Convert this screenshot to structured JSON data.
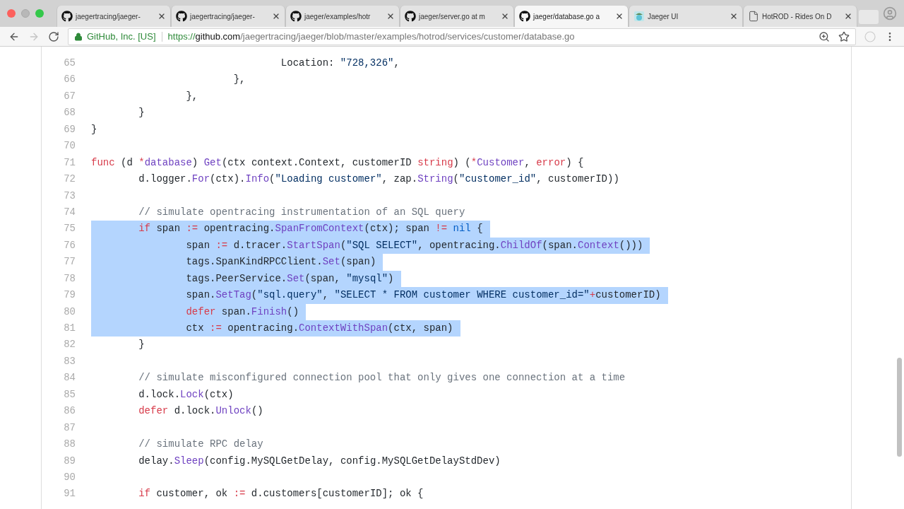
{
  "tabs": [
    {
      "title": "jaegertracing/jaeger-",
      "kind": "github",
      "selected": false
    },
    {
      "title": "jaegertracing/jaeger-",
      "kind": "github",
      "selected": false
    },
    {
      "title": "jaeger/examples/hotr",
      "kind": "github",
      "selected": false
    },
    {
      "title": "jaeger/server.go at m",
      "kind": "github",
      "selected": false
    },
    {
      "title": "jaeger/database.go a",
      "kind": "github",
      "selected": true
    },
    {
      "title": "Jaeger UI",
      "kind": "jaeger",
      "selected": false
    },
    {
      "title": "HotROD - Rides On D",
      "kind": "page",
      "selected": false
    }
  ],
  "address_bar": {
    "site_identity": "GitHub, Inc. [US]",
    "scheme": "https://",
    "host": "github.com",
    "path": "/jaegertracing/jaeger/blob/master/examples/hotrod/services/customer/database.go"
  },
  "code": {
    "lines": [
      {
        "number": "65",
        "selected": false,
        "tokens": [
          {
            "text": "\t\t\t\tLocation: ",
            "kind": "plain"
          },
          {
            "text": "\"728,326\"",
            "kind": "string"
          },
          {
            "text": ",",
            "kind": "plain"
          }
        ]
      },
      {
        "number": "66",
        "selected": false,
        "tokens": [
          {
            "text": "\t\t\t},",
            "kind": "plain"
          }
        ]
      },
      {
        "number": "67",
        "selected": false,
        "tokens": [
          {
            "text": "\t\t},",
            "kind": "plain"
          }
        ]
      },
      {
        "number": "68",
        "selected": false,
        "tokens": [
          {
            "text": "\t}",
            "kind": "plain"
          }
        ]
      },
      {
        "number": "69",
        "selected": false,
        "tokens": [
          {
            "text": "}",
            "kind": "plain"
          }
        ]
      },
      {
        "number": "70",
        "selected": false
      },
      {
        "number": "71",
        "selected": false,
        "tokens": [
          {
            "text": "func",
            "kind": "keyword"
          },
          {
            "text": " (d ",
            "kind": "plain"
          },
          {
            "text": "*",
            "kind": "keyword"
          },
          {
            "text": "database",
            "kind": "entity"
          },
          {
            "text": ") ",
            "kind": "plain"
          },
          {
            "text": "Get",
            "kind": "entity"
          },
          {
            "text": "(ctx context.Context, customerID ",
            "kind": "plain"
          },
          {
            "text": "string",
            "kind": "keyword"
          },
          {
            "text": ") (",
            "kind": "plain"
          },
          {
            "text": "*",
            "kind": "keyword"
          },
          {
            "text": "Customer",
            "kind": "entity"
          },
          {
            "text": ", ",
            "kind": "plain"
          },
          {
            "text": "error",
            "kind": "keyword"
          },
          {
            "text": ") {",
            "kind": "plain"
          }
        ]
      },
      {
        "number": "72",
        "selected": false,
        "tokens": [
          {
            "text": "\td.logger.",
            "kind": "plain"
          },
          {
            "text": "For",
            "kind": "entity"
          },
          {
            "text": "(ctx).",
            "kind": "plain"
          },
          {
            "text": "Info",
            "kind": "entity"
          },
          {
            "text": "(",
            "kind": "plain"
          },
          {
            "text": "\"Loading customer\"",
            "kind": "string"
          },
          {
            "text": ", zap.",
            "kind": "plain"
          },
          {
            "text": "String",
            "kind": "entity"
          },
          {
            "text": "(",
            "kind": "plain"
          },
          {
            "text": "\"customer_id\"",
            "kind": "string"
          },
          {
            "text": ", customerID))",
            "kind": "plain"
          }
        ]
      },
      {
        "number": "73",
        "selected": false
      },
      {
        "number": "74",
        "selected": false,
        "tokens": [
          {
            "text": "\t// simulate opentracing instrumentation of an SQL query",
            "kind": "comment"
          }
        ]
      },
      {
        "number": "75",
        "selected": true,
        "tokens": [
          {
            "text": "\tif",
            "kind": "keyword"
          },
          {
            "text": " span ",
            "kind": "plain"
          },
          {
            "text": ":=",
            "kind": "keyword"
          },
          {
            "text": " opentracing.",
            "kind": "plain"
          },
          {
            "text": "SpanFromContext",
            "kind": "entity"
          },
          {
            "text": "(ctx); span ",
            "kind": "plain"
          },
          {
            "text": "!=",
            "kind": "keyword"
          },
          {
            "text": " nil",
            "kind": "constant"
          },
          {
            "text": " {",
            "kind": "plain"
          }
        ]
      },
      {
        "number": "76",
        "selected": true,
        "tokens": [
          {
            "text": "\t\tspan ",
            "kind": "plain"
          },
          {
            "text": ":=",
            "kind": "keyword"
          },
          {
            "text": " d.tracer.",
            "kind": "plain"
          },
          {
            "text": "StartSpan",
            "kind": "entity"
          },
          {
            "text": "(",
            "kind": "plain"
          },
          {
            "text": "\"SQL SELECT\"",
            "kind": "string"
          },
          {
            "text": ", opentracing.",
            "kind": "plain"
          },
          {
            "text": "ChildOf",
            "kind": "entity"
          },
          {
            "text": "(span.",
            "kind": "plain"
          },
          {
            "text": "Context",
            "kind": "entity"
          },
          {
            "text": "()))",
            "kind": "plain"
          }
        ]
      },
      {
        "number": "77",
        "selected": true,
        "tokens": [
          {
            "text": "\t\ttags.SpanKindRPCClient.",
            "kind": "plain"
          },
          {
            "text": "Set",
            "kind": "entity"
          },
          {
            "text": "(span)",
            "kind": "plain"
          }
        ]
      },
      {
        "number": "78",
        "selected": true,
        "tokens": [
          {
            "text": "\t\ttags.PeerService.",
            "kind": "plain"
          },
          {
            "text": "Set",
            "kind": "entity"
          },
          {
            "text": "(span, ",
            "kind": "plain"
          },
          {
            "text": "\"mysql\"",
            "kind": "string"
          },
          {
            "text": ")",
            "kind": "plain"
          }
        ]
      },
      {
        "number": "79",
        "selected": true,
        "tokens": [
          {
            "text": "\t\tspan.",
            "kind": "plain"
          },
          {
            "text": "SetTag",
            "kind": "entity"
          },
          {
            "text": "(",
            "kind": "plain"
          },
          {
            "text": "\"sql.query\"",
            "kind": "string"
          },
          {
            "text": ", ",
            "kind": "plain"
          },
          {
            "text": "\"SELECT * FROM customer WHERE customer_id=\"",
            "kind": "string"
          },
          {
            "text": "+",
            "kind": "keyword"
          },
          {
            "text": "customerID)",
            "kind": "plain"
          }
        ]
      },
      {
        "number": "80",
        "selected": true,
        "tokens": [
          {
            "text": "\t\tdefer",
            "kind": "keyword"
          },
          {
            "text": " span.",
            "kind": "plain"
          },
          {
            "text": "Finish",
            "kind": "entity"
          },
          {
            "text": "()",
            "kind": "plain"
          }
        ]
      },
      {
        "number": "81",
        "selected": true,
        "tokens": [
          {
            "text": "\t\tctx ",
            "kind": "plain"
          },
          {
            "text": ":=",
            "kind": "keyword"
          },
          {
            "text": " opentracing.",
            "kind": "plain"
          },
          {
            "text": "ContextWithSpan",
            "kind": "entity"
          },
          {
            "text": "(ctx, span)",
            "kind": "plain"
          }
        ]
      },
      {
        "number": "82",
        "selected": false,
        "tokens": [
          {
            "text": "\t}",
            "kind": "plain"
          }
        ]
      },
      {
        "number": "83",
        "selected": false
      },
      {
        "number": "84",
        "selected": false,
        "tokens": [
          {
            "text": "\t// simulate misconfigured connection pool that only gives one connection at a time",
            "kind": "comment"
          }
        ]
      },
      {
        "number": "85",
        "selected": false,
        "tokens": [
          {
            "text": "\td.lock.",
            "kind": "plain"
          },
          {
            "text": "Lock",
            "kind": "entity"
          },
          {
            "text": "(ctx)",
            "kind": "plain"
          }
        ]
      },
      {
        "number": "86",
        "selected": false,
        "tokens": [
          {
            "text": "\tdefer",
            "kind": "keyword"
          },
          {
            "text": " d.lock.",
            "kind": "plain"
          },
          {
            "text": "Unlock",
            "kind": "entity"
          },
          {
            "text": "()",
            "kind": "plain"
          }
        ]
      },
      {
        "number": "87",
        "selected": false
      },
      {
        "number": "88",
        "selected": false,
        "tokens": [
          {
            "text": "\t// simulate RPC delay",
            "kind": "comment"
          }
        ]
      },
      {
        "number": "89",
        "selected": false,
        "tokens": [
          {
            "text": "\tdelay.",
            "kind": "plain"
          },
          {
            "text": "Sleep",
            "kind": "entity"
          },
          {
            "text": "(config.MySQLGetDelay, config.MySQLGetDelayStdDev)",
            "kind": "plain"
          }
        ]
      },
      {
        "number": "90",
        "selected": false
      },
      {
        "number": "91",
        "selected": false,
        "tokens": [
          {
            "text": "\tif",
            "kind": "keyword"
          },
          {
            "text": " customer, ok ",
            "kind": "plain"
          },
          {
            "text": ":=",
            "kind": "keyword"
          },
          {
            "text": " d.customers[customerID]; ok {",
            "kind": "plain"
          }
        ]
      }
    ]
  }
}
